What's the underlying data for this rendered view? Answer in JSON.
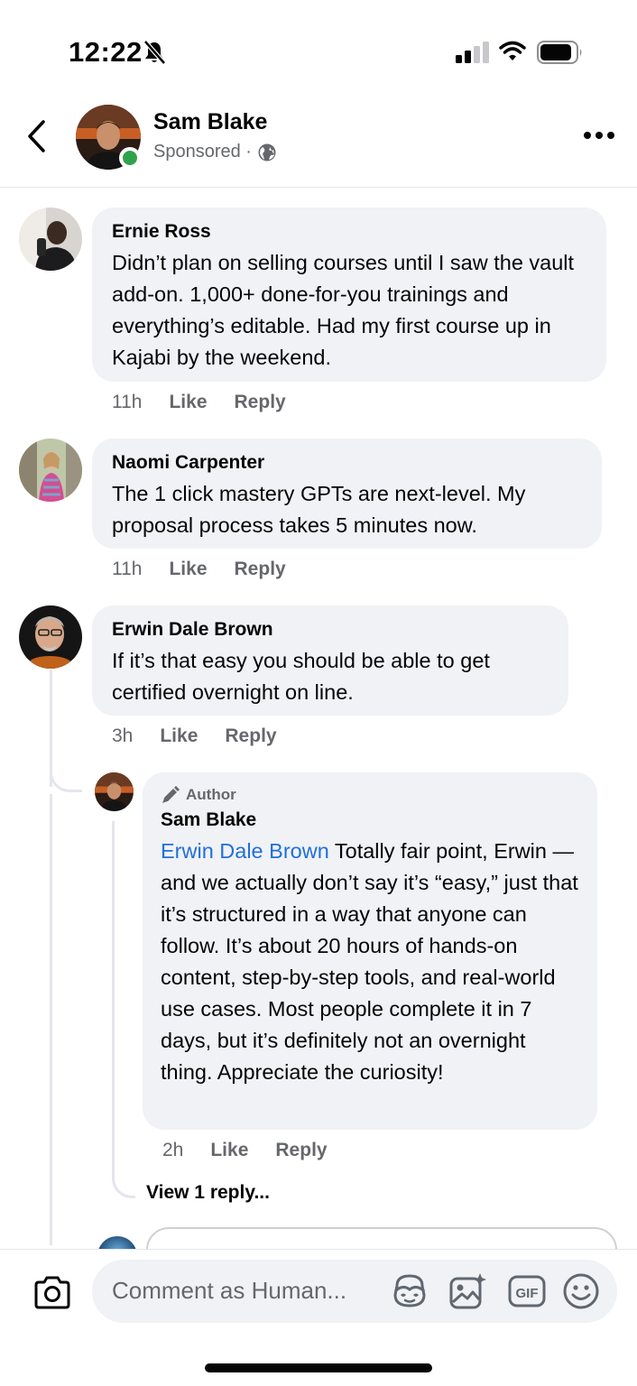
{
  "status_bar": {
    "time": "12:22"
  },
  "header": {
    "name": "Sam Blake",
    "subtitle": "Sponsored ·"
  },
  "comments": [
    {
      "name": "Ernie Ross",
      "text": "Didn’t plan on selling courses until I saw the vault add-on. 1,000+ done-for-you trainings and everything’s editable. Had my first course up in Kajabi by the weekend.",
      "time": "11h",
      "like": "Like",
      "reply": "Reply"
    },
    {
      "name": "Naomi Carpenter",
      "text": "The 1 click mastery GPTs are next-level. My proposal process takes 5 minutes now.",
      "time": "11h",
      "like": "Like",
      "reply": "Reply"
    },
    {
      "name": "Erwin Dale Brown",
      "text": "If it’s that easy you should be able to get certified overnight on line.",
      "time": "3h",
      "like": "Like",
      "reply": "Reply"
    }
  ],
  "author_reply": {
    "badge": "Author",
    "name": "Sam Blake",
    "mention": "Erwin Dale Brown",
    "text": " Totally fair point, Erwin — and we actually don’t say it’s “easy,” just that it’s structured in a way that anyone can follow. It’s about 20 hours of hands-on content, step-by-step tools, and real-world use cases. Most people complete it in 7 days, but it’s definitely not an overnight thing. Appreciate the curiosity!",
    "time": "2h",
    "like": "Like",
    "reply": "Reply"
  },
  "view_replies": "View 1 reply...",
  "composer": {
    "placeholder": "Comment as Human..."
  },
  "colors": {
    "bubble": "#f0f2f5",
    "mention": "#216fdb",
    "online": "#31a24c",
    "secondary_text": "#65676b"
  },
  "icons": [
    "bell-muted-icon",
    "signal-icon",
    "wifi-icon",
    "battery-icon",
    "back-chevron-icon",
    "globe-icon",
    "more-icon",
    "pencil-icon",
    "camera-icon",
    "avatar-sticker-icon",
    "image-sparkle-icon",
    "gif-icon",
    "emoji-icon"
  ]
}
